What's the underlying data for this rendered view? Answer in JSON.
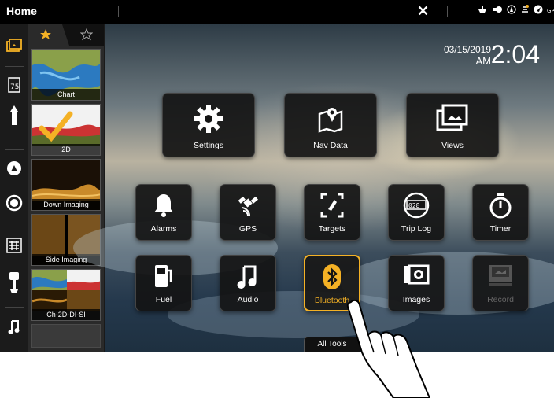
{
  "topbar": {
    "title": "Home"
  },
  "clock": {
    "date": "03/15/2019",
    "ampm": "AM",
    "time": "2:04"
  },
  "favorites": {
    "items": [
      {
        "label": "Chart"
      },
      {
        "label": "2D"
      },
      {
        "label": "Down Imaging"
      },
      {
        "label": "Side Imaging"
      },
      {
        "label": "Ch-2D-DI-SI"
      }
    ]
  },
  "tiles": {
    "settings": "Settings",
    "nav_data": "Nav Data",
    "views": "Views",
    "alarms": "Alarms",
    "gps": "GPS",
    "targets": "Targets",
    "trip_log": "Trip Log",
    "timer": "Timer",
    "fuel": "Fuel",
    "audio": "Audio",
    "bluetooth": "Bluetooth",
    "images": "Images",
    "record": "Record"
  },
  "footer": {
    "all_tools": "All Tools"
  },
  "colors": {
    "accent": "#f4b125",
    "topbar": "#000000"
  }
}
